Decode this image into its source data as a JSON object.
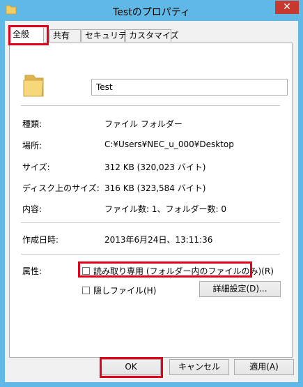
{
  "window": {
    "title": "Testのプロパティ",
    "close_symbol": "✕",
    "folder_color": "#f2cd66",
    "highlight_color": "#e3001b"
  },
  "tabs": [
    {
      "label": "全般"
    },
    {
      "label": "共有"
    },
    {
      "label": "セキュリティ"
    },
    {
      "label": "カスタマイズ"
    }
  ],
  "general": {
    "folder_name": "Test",
    "rows": [
      {
        "label": "種類:",
        "value": "ファイル フォルダー"
      },
      {
        "label": "場所:",
        "value": "C:¥Users¥NEC_u_000¥Desktop"
      },
      {
        "label": "サイズ:",
        "value": "312 KB (320,023 バイト)"
      },
      {
        "label": "ディスク上のサイズ:",
        "value": "316 KB (323,584 バイト)"
      },
      {
        "label": "内容:",
        "value": "ファイル数: 1、フォルダー数: 0"
      }
    ],
    "created_label": "作成日時:",
    "created_value": "2013年6月24日、13:11:36",
    "attributes_label": "属性:",
    "readonly_label": "読み取り専用 (フォルダー内のファイルのみ)(R)",
    "hidden_label": "隠しファイル(H)",
    "advanced_button": "詳細設定(D)..."
  },
  "buttons": {
    "ok": "OK",
    "cancel": "キャンセル",
    "apply": "適用(A)"
  }
}
